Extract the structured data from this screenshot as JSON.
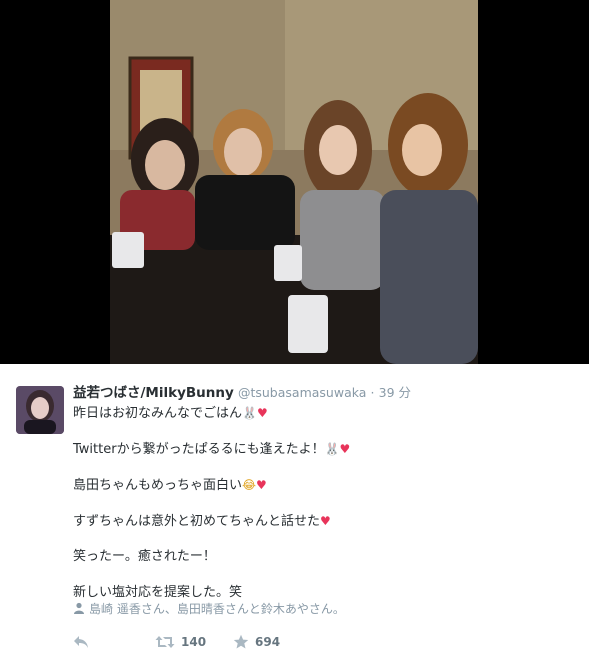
{
  "tweet": {
    "display_name": "益若つばさ/MilkyBunny",
    "handle": "@tsubasamasuwaka",
    "separator": "·",
    "time": "39 分",
    "lines": [
      "昨日はお初なみんなでごはん",
      "Twitterから繋がったぱるるにも逢えたよ！",
      "島田ちゃんもめっちゃ面白い",
      "すずちゃんは意外と初めてちゃんと話せた",
      "笑ったー。癒されたー！",
      "新しい塩対応を提案した。笑"
    ],
    "tagged_people": "島崎 遥香さん、島田晴香さんと鈴木あやさん。",
    "retweet_count": "140",
    "favorite_count": "694"
  },
  "icons": {
    "reply": "reply-icon",
    "retweet": "retweet-icon",
    "favorite": "star-icon",
    "tag": "person-icon"
  },
  "colors": {
    "name": "#292f33",
    "meta": "#8899a6",
    "heart": "#e8345a",
    "photo_background": "#000000"
  }
}
